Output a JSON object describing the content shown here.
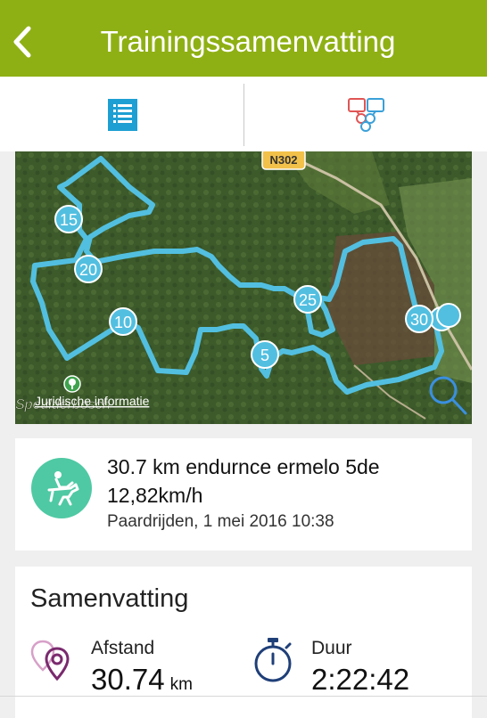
{
  "header": {
    "title": "Trainingssamenvatting",
    "bg_color": "#8fb014"
  },
  "tabs": [
    {
      "name": "summary-list",
      "icon": "list-icon",
      "active": true
    },
    {
      "name": "social",
      "icon": "chat-bubbles-icon",
      "active": false
    }
  ],
  "map": {
    "road_label": "N302",
    "place_label": "Speulderbosch",
    "legal_link": "Juridische informatie",
    "route_color": "#52bfe0",
    "markers": [
      "15",
      "20",
      "10",
      "25",
      "5",
      "30"
    ]
  },
  "activity": {
    "icon": "horse-riding-icon",
    "icon_color": "#4fc9a3",
    "name": "30.7 km endurnce ermelo 5de",
    "speed": "12,82km/h",
    "meta": "Paardrijden, 1 mei 2016 10:38"
  },
  "summary": {
    "title": "Samenvatting",
    "distance": {
      "icon": "map-pin-icon",
      "label": "Afstand",
      "value": "30.74",
      "unit": "km"
    },
    "duration": {
      "icon": "stopwatch-icon",
      "label": "Duur",
      "value": "2:22:42"
    }
  }
}
